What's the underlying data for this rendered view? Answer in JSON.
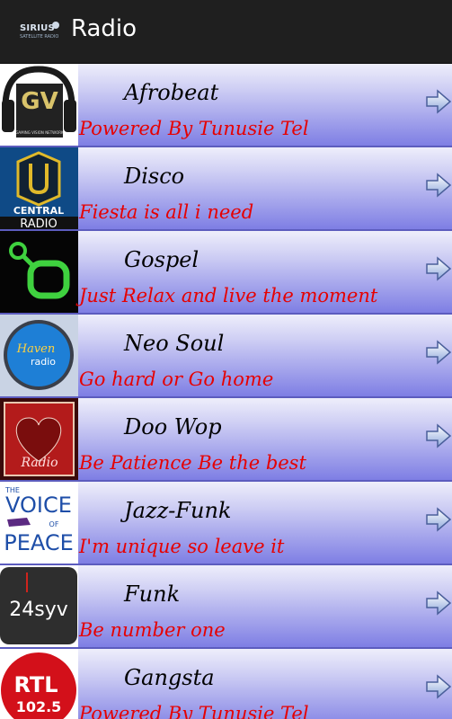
{
  "header": {
    "logo_text": "SIRIUS",
    "logo_subtext": "SATELLITE RADIO",
    "title": "Radio"
  },
  "stations": [
    {
      "genre": "Afrobeat",
      "tagline": "Powered By Tunusie Tel",
      "logo": "gv-headphones-logo",
      "logo_text_1": "GV",
      "logo_text_2": "GAMING VISION NETWORK"
    },
    {
      "genre": "Disco",
      "tagline": "Fiesta is all i need",
      "logo": "central-radio-logo",
      "logo_text_1": "CENTRAL",
      "logo_text_2": "RADIO"
    },
    {
      "genre": "Gospel",
      "tagline": "Just Relax and live the moment",
      "logo": "green-o-logo"
    },
    {
      "genre": "Neo Soul",
      "tagline": "Go hard or Go home",
      "logo": "haven-radio-logo",
      "logo_text_1": "Haven",
      "logo_text_2": "radio"
    },
    {
      "genre": "Doo Wop",
      "tagline": "Be Patience Be the best",
      "logo": "heart-radio-logo",
      "logo_text_1": "Radio"
    },
    {
      "genre": "Jazz-Funk",
      "tagline": "I'm unique so leave it",
      "logo": "voice-of-peace-logo",
      "logo_text_1": "THE",
      "logo_text_2": "VOICE",
      "logo_text_3": "OF",
      "logo_text_4": "PEACE"
    },
    {
      "genre": "Funk",
      "tagline": "Be number one",
      "logo": "24syv-logo",
      "logo_text_1": "24syv"
    },
    {
      "genre": "Gangsta",
      "tagline": "Powered By Tunusie Tel",
      "logo": "rtl-1025-logo",
      "logo_text_1": "RTL",
      "logo_text_2": "102.5"
    }
  ],
  "colors": {
    "genre_text": "#000000",
    "tagline_text": "#e60000",
    "row_gradient_top": "#eeeefb",
    "row_gradient_bottom": "#7e7ee4",
    "action_bar": "#1f1f1f"
  },
  "icons": {
    "row_action": "arrow-right-icon"
  }
}
